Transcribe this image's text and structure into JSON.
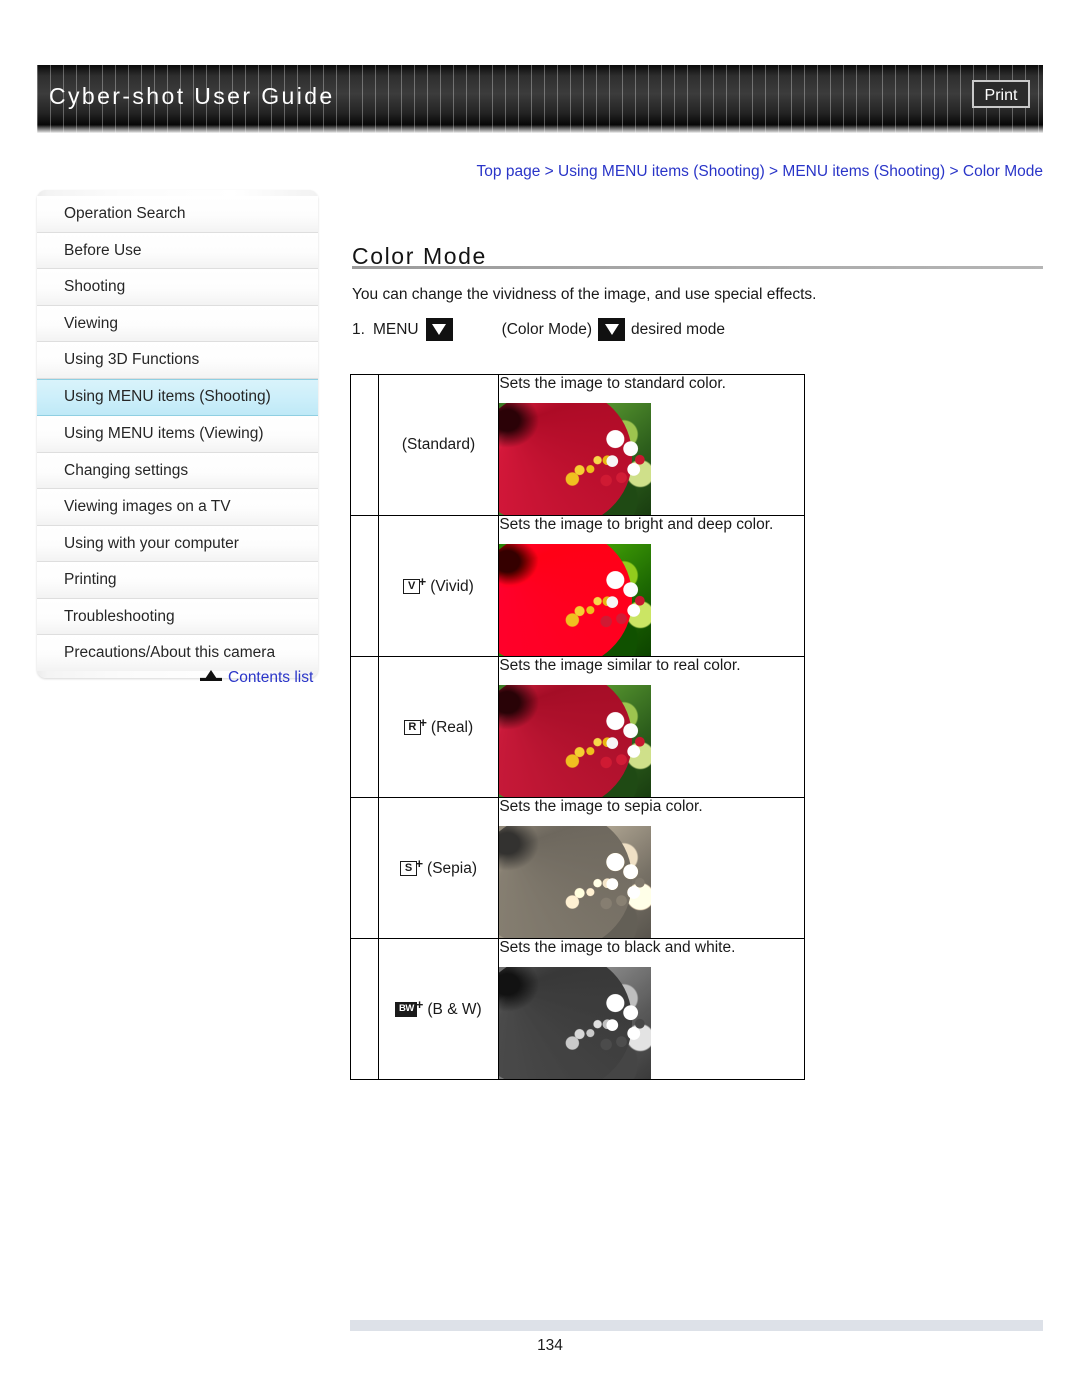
{
  "header": {
    "title": "Cyber-shot User Guide",
    "print_label": "Print"
  },
  "breadcrumb": {
    "separator": " > ",
    "items": [
      "Top page",
      "Using MENU items (Shooting)",
      "MENU items (Shooting)",
      "Color Mode"
    ]
  },
  "sidebar": {
    "items": [
      {
        "label": "Operation Search",
        "active": false
      },
      {
        "label": "Before Use",
        "active": false
      },
      {
        "label": "Shooting",
        "active": false
      },
      {
        "label": "Viewing",
        "active": false
      },
      {
        "label": "Using 3D Functions",
        "active": false
      },
      {
        "label": "Using MENU items (Shooting)",
        "active": true
      },
      {
        "label": "Using MENU items (Viewing)",
        "active": false
      },
      {
        "label": "Changing settings",
        "active": false
      },
      {
        "label": "Viewing images on a TV",
        "active": false
      },
      {
        "label": "Using with your computer",
        "active": false
      },
      {
        "label": "Printing",
        "active": false
      },
      {
        "label": "Troubleshooting",
        "active": false
      },
      {
        "label": "Precautions/About this camera",
        "active": false
      }
    ],
    "contents_list_label": "Contents list",
    "contents_list_icon": "up-arrow-bar-icon"
  },
  "main": {
    "page_title": "Color Mode",
    "intro_text": "You can change the vividness of the image, and use special effects.",
    "step": {
      "number": "1.",
      "word_menu": "MENU",
      "arrow_icon_1": "down-triangle-icon",
      "paren_label": "(Color Mode)",
      "arrow_icon_2": "down-triangle-icon",
      "tail_label": "desired mode"
    },
    "table_rows": [
      {
        "icon": "",
        "icon_style": "none",
        "label": "(Standard)",
        "description": "Sets the image to standard color.",
        "photo_variant": "standard"
      },
      {
        "icon": "V",
        "icon_style": "outline-plus",
        "label": "(Vivid)",
        "description": "Sets the image to bright and deep color.",
        "photo_variant": "vivid"
      },
      {
        "icon": "R",
        "icon_style": "outline-plus",
        "label": "(Real)",
        "description": "Sets the image similar to real color.",
        "photo_variant": "real"
      },
      {
        "icon": "S",
        "icon_style": "outline-plus",
        "label": "(Sepia)",
        "description": "Sets the image to sepia color.",
        "photo_variant": "sepia"
      },
      {
        "icon": "BW",
        "icon_style": "inverted-plus",
        "label": "(B & W)",
        "description": "Sets the image to black and white.",
        "photo_variant": "bw"
      }
    ]
  },
  "footer": {
    "page_number": "134"
  },
  "colors": {
    "link": "#2a35c8",
    "active_nav": "#cdeffa",
    "header_dark": "#2e2e2e",
    "footer_bar": "#dde1e8"
  }
}
